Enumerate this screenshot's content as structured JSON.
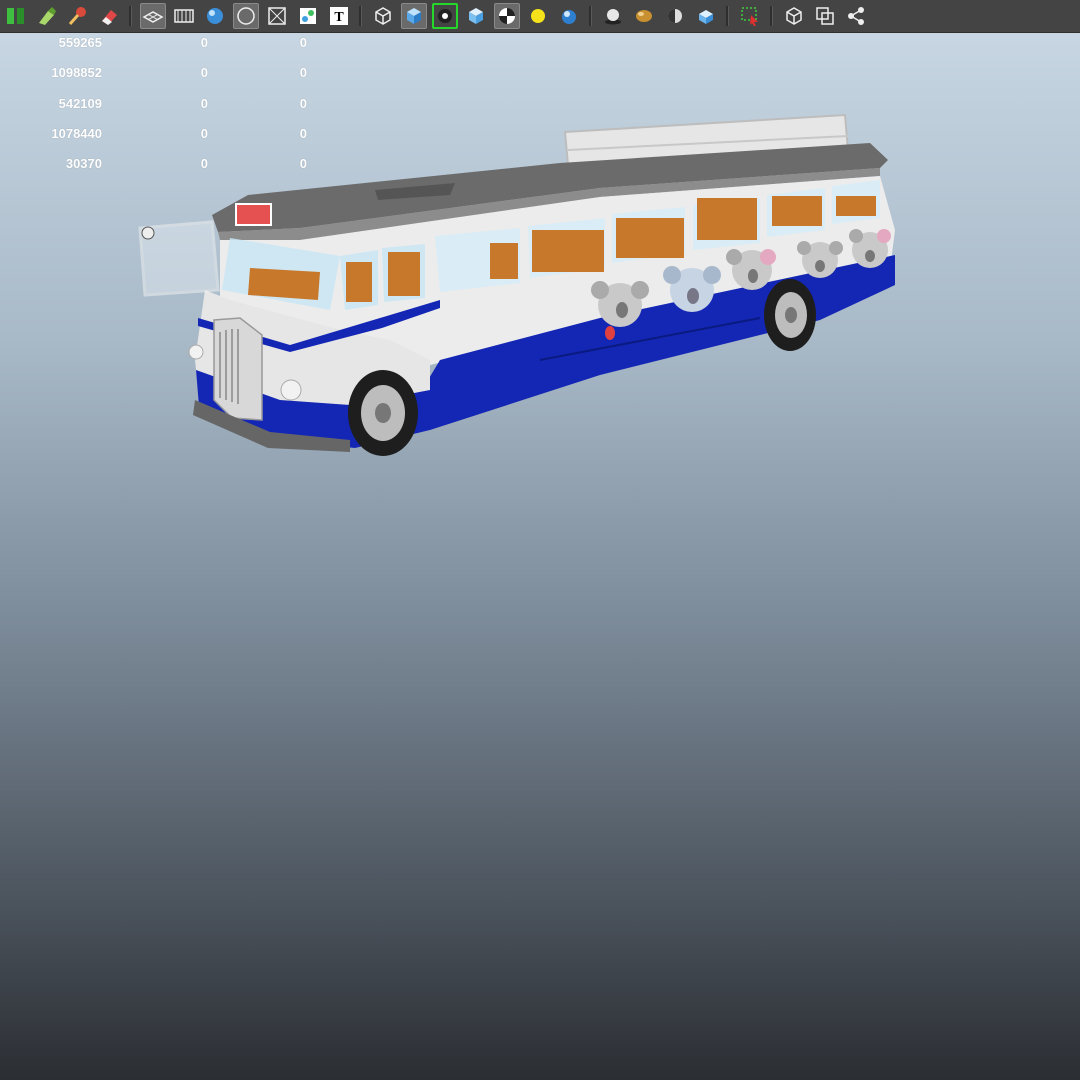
{
  "toolbar": {
    "icons": [
      "snap-icon",
      "sculpt-brush-icon",
      "paint-weights-icon",
      "eraser-icon",
      "separator",
      "grid-plane-icon",
      "film-gate-icon",
      "smooth-shade-icon",
      "wireframe-shade-icon",
      "xray-icon",
      "uv-texture-icon",
      "text-icon",
      "separator",
      "cube-wireframe-icon",
      "cube-shaded-icon",
      "isolate-select-icon",
      "cube-textured-icon",
      "checker-icon",
      "light-bulb-icon",
      "blue-sphere-icon",
      "separator",
      "shadow-sphere-icon",
      "ambient-occlusion-icon",
      "half-sphere-icon",
      "motion-blur-icon",
      "separator",
      "select-region-icon",
      "separator",
      "camera-cube-icon",
      "copy-frames-icon",
      "share-icon"
    ],
    "active_icon": "isolate-select-icon"
  },
  "stats": {
    "rows": [
      {
        "a": "559265",
        "b": "0",
        "c": "0"
      },
      {
        "a": "1098852",
        "b": "0",
        "c": "0"
      },
      {
        "a": "542109",
        "b": "0",
        "c": "0"
      },
      {
        "a": "1078440",
        "b": "0",
        "c": "0"
      },
      {
        "a": "30370",
        "b": "0",
        "c": "0"
      }
    ]
  },
  "colors": {
    "bus_blue": "#1427b4",
    "bus_white": "#ececec",
    "roof_gray": "#6b6b6b",
    "seat_orange": "#c8782a",
    "viewport_top": "#c7d6e2",
    "viewport_bottom": "#2b2e33"
  }
}
